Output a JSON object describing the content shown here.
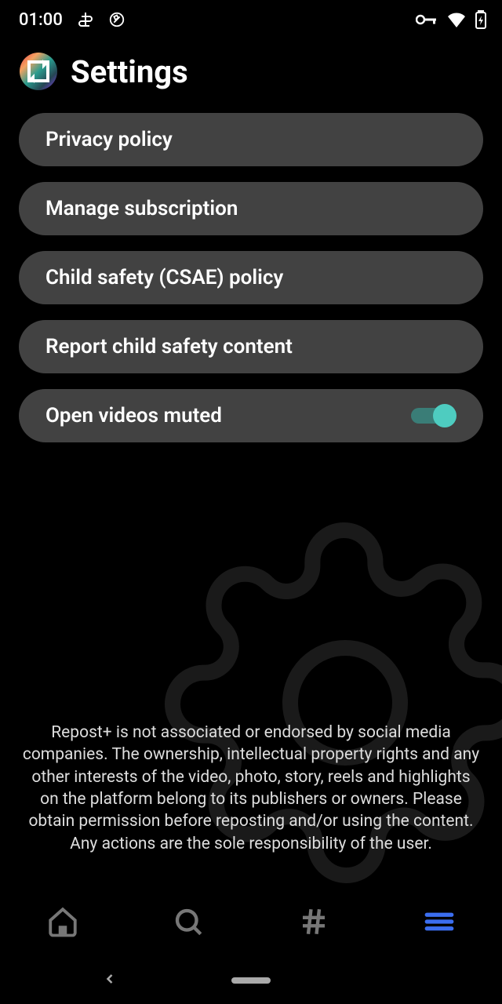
{
  "status": {
    "time": "01:00"
  },
  "header": {
    "title": "Settings"
  },
  "settings": {
    "items": [
      {
        "label": "Privacy policy"
      },
      {
        "label": "Manage subscription"
      },
      {
        "label": "Child safety (CSAE) policy"
      },
      {
        "label": "Report child safety content"
      }
    ],
    "toggle": {
      "label": "Open videos muted",
      "on": true
    }
  },
  "disclaimer": "Repost+ is not associated or endorsed by social media companies. The ownership, intellectual property rights and any other interests of the video, photo, story, reels and highlights on the platform belong to its publishers or owners. Please obtain permission before reposting and/or using the content. Any actions are the sole responsibility of the user."
}
